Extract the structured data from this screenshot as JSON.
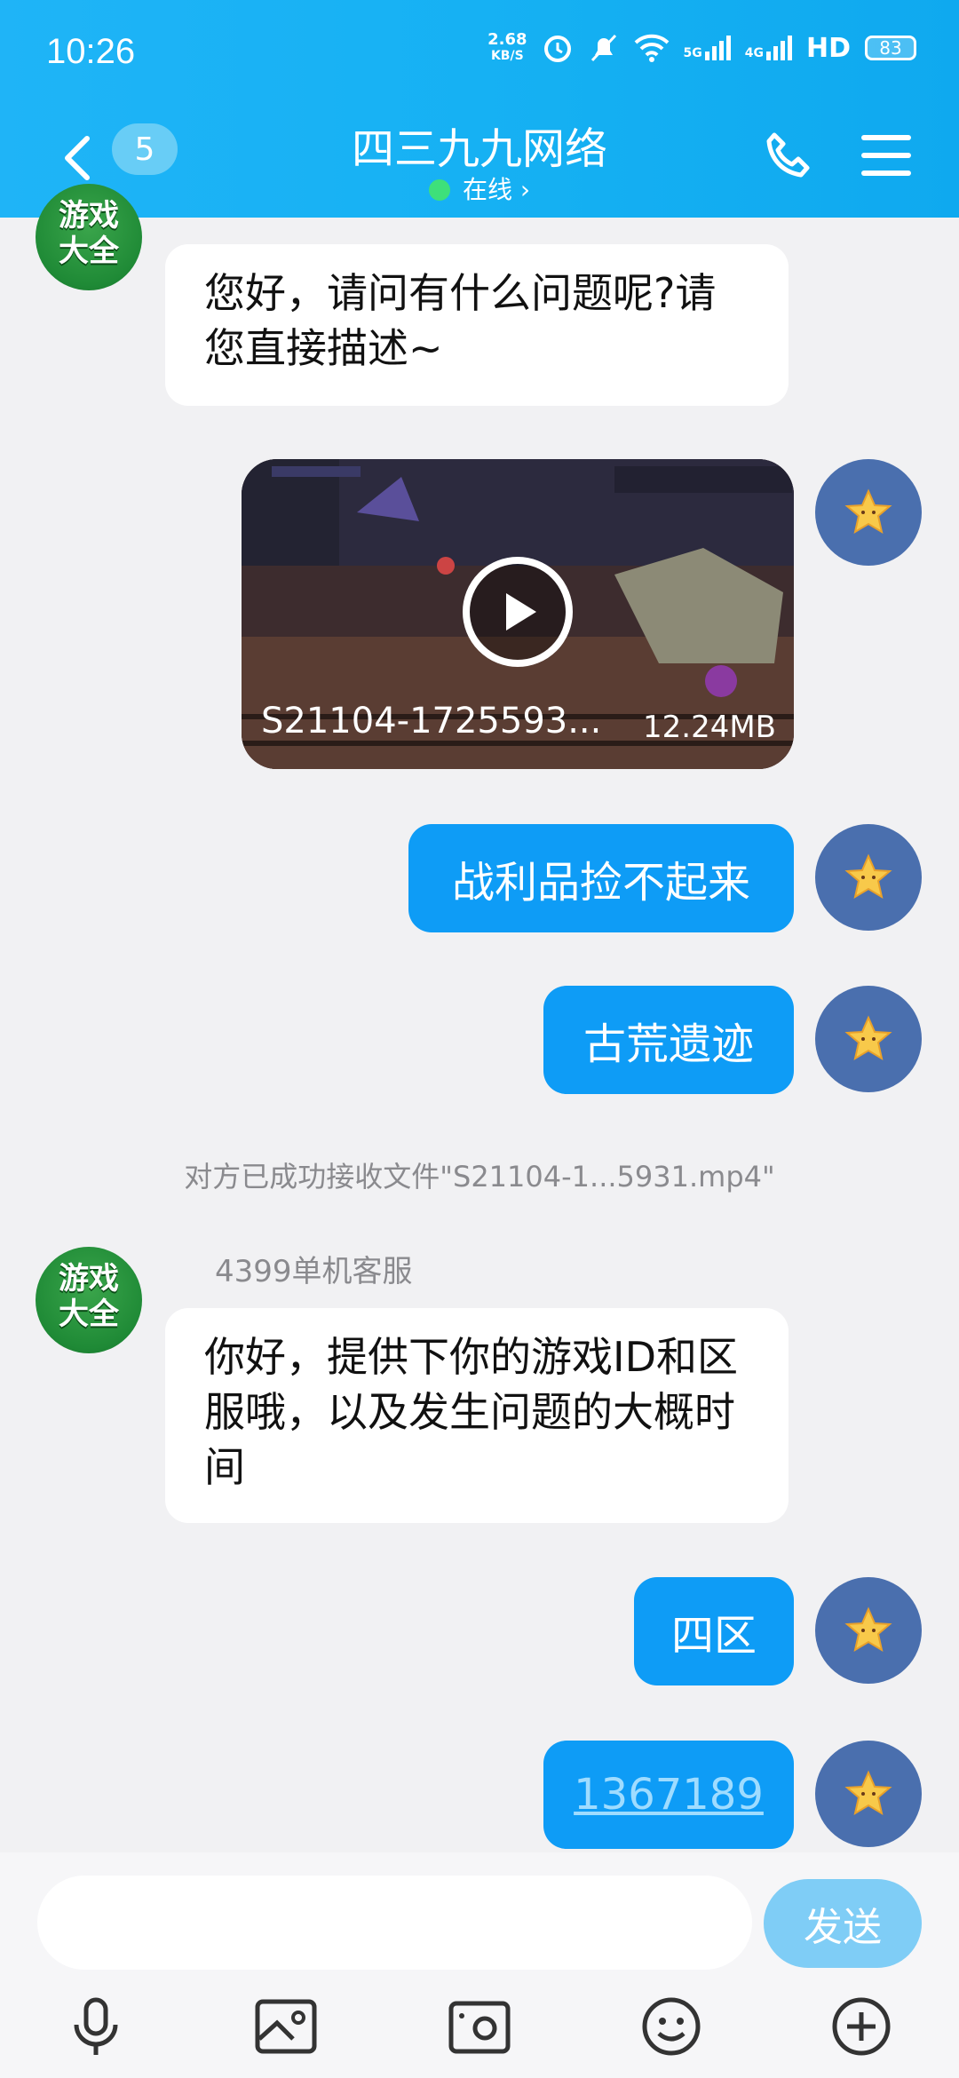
{
  "status_bar": {
    "time": "10:26",
    "net_speed_top": "2.68",
    "net_speed_unit": "KB/S",
    "signal1": "5G",
    "signal2": "4G",
    "hd": "HD",
    "battery": "83"
  },
  "header": {
    "unread_count": "5",
    "title": "四三九九网络",
    "presence": "在线 ›"
  },
  "messages": {
    "m1_text": "您好，请问有什么问题呢?请您直接描述~",
    "video_filename": "S21104-1725593...",
    "video_size": "12.24MB",
    "m3_text": "战利品捡不起来",
    "m4_text": "古荒遗迹",
    "system_notice": "对方已成功接收文件\"S21104-1...5931.mp4\"",
    "sender_name": "4399单机客服",
    "m5_text": "你好，提供下你的游戏ID和区服哦，以及发生问题的大概时间",
    "m6_text": "四区",
    "m7_text": "1367189"
  },
  "avatar_game": {
    "line1": "游戏",
    "line2": "大全"
  },
  "input": {
    "placeholder": "",
    "send_label": "发送"
  },
  "toolbar": {
    "icons": [
      "mic-icon",
      "image-icon",
      "camera-icon",
      "emoji-icon",
      "plus-icon"
    ]
  }
}
